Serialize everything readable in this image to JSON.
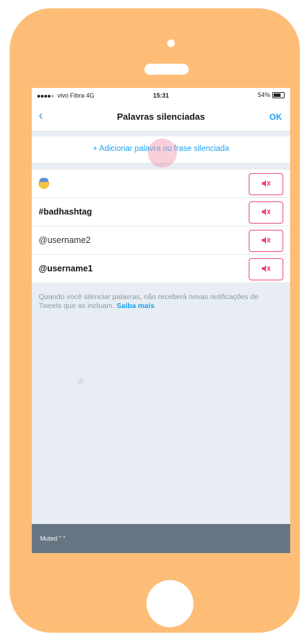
{
  "status_bar": {
    "carrier": "vivo Fibra 4G",
    "time": "15:31",
    "battery": "54%"
  },
  "nav": {
    "back_icon": "chevron-left-icon",
    "title": "Palavras silenciadas",
    "ok_label": "OK"
  },
  "add_phrase": {
    "label": "+ Adicionar palavra ou frase silenciada"
  },
  "muted_items": [
    {
      "label": "",
      "icon": "emoji-icon"
    },
    {
      "label": "#badhashtag"
    },
    {
      "label": "@username2"
    },
    {
      "label": "@username1"
    }
  ],
  "unmute_icon": "unmute-icon",
  "info": {
    "text": "Quando você silenciar palavras, não receberá novas notificações de Tweets que as incluam.",
    "link": "Saiba mais"
  },
  "bottom_bar": {
    "text": "Muted \" \""
  },
  "colors": {
    "phone_body": "#fdbd76",
    "accent": "#1da1f2",
    "unmute_border": "#e8457a",
    "bottom_bar": "#667582"
  }
}
